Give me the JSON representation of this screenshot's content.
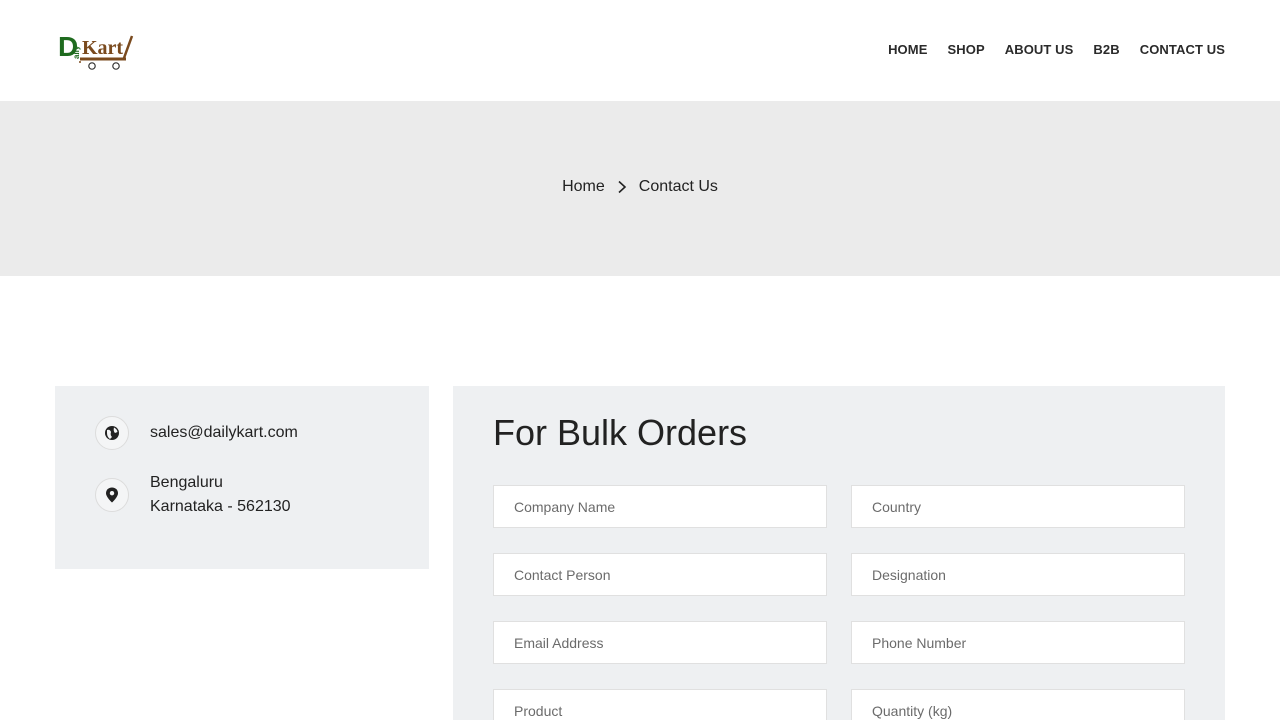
{
  "header": {
    "nav": [
      "HOME",
      "SHOP",
      "ABOUT US",
      "B2B",
      "CONTACT US"
    ]
  },
  "breadcrumb": {
    "home": "Home",
    "current": "Contact Us"
  },
  "info": {
    "email": "sales@dailykart.com",
    "address_line1": "Bengaluru",
    "address_line2": "Karnataka - 562130"
  },
  "form": {
    "title": "For Bulk Orders",
    "fields": {
      "company": "Company Name",
      "country": "Country",
      "contact_person": "Contact Person",
      "designation": "Designation",
      "email": "Email Address",
      "phone": "Phone Number",
      "product": "Product",
      "quantity": "Quantity (kg)"
    }
  },
  "colors": {
    "logo_green": "#1f6b1f",
    "logo_brown": "#7a4a1e",
    "band_bg": "#ebebeb",
    "card_bg": "#eef0f2"
  }
}
